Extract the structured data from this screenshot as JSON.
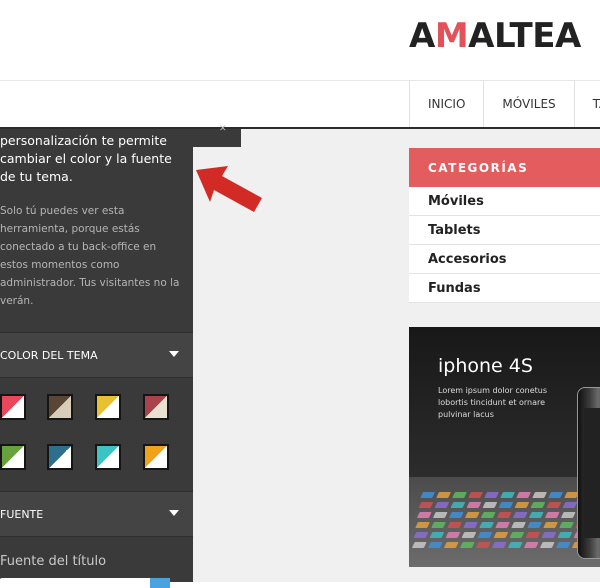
{
  "header": {
    "logo_prefix": "A",
    "logo_accent": "M",
    "logo_suffix": "ALTEA",
    "nav": [
      "INICIO",
      "MÓVILES",
      "TA"
    ]
  },
  "sidebar": {
    "title": "personalización te permite cambiar el color y la fuente de tu tema.",
    "description": "Solo tú puedes ver esta herramienta, porque estás conectado a tu back-office en estos momentos como administrador. Tus visitantes no la verán.",
    "color_section": "COLOR DEL TEMA",
    "font_section": "FUENTE",
    "font_title_label": "Fuente del título",
    "swatches": [
      {
        "a": "#e8485a",
        "b": "#ffffff"
      },
      {
        "a": "#5a4636",
        "b": "#d8cdb8"
      },
      {
        "a": "#e8c12e",
        "b": "#ffffff"
      },
      {
        "a": "#a8424b",
        "b": "#e9e0d2"
      },
      {
        "a": "#67a23d",
        "b": "#ffffff"
      },
      {
        "a": "#2e6f8e",
        "b": "#ffffff"
      },
      {
        "a": "#3cc4c4",
        "b": "#ffffff"
      },
      {
        "a": "#f0a21a",
        "b": "#ffffff"
      }
    ]
  },
  "categories": {
    "heading": "CATEGORÍAS",
    "items": [
      "Móviles",
      "Tablets",
      "Accesorios",
      "Fundas"
    ]
  },
  "promo": {
    "title": "iphone 4S",
    "text": "Lorem ipsum dolor conetus lobortis tincidunt et ornare pulvinar lacus"
  },
  "colors": {
    "accent": "#e35d5e",
    "panel": "#3a3a3a",
    "arrow": "#d22b26"
  }
}
